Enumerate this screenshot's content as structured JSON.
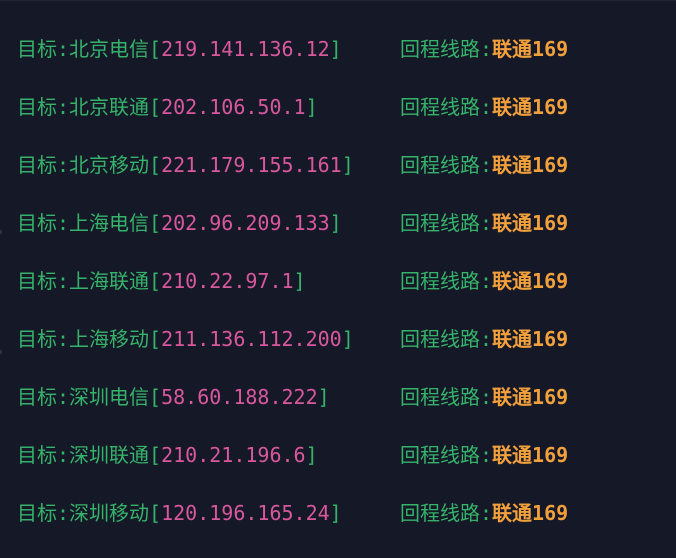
{
  "rows": [
    {
      "target_label": "目标:",
      "target_name": "北京电信",
      "ip": "219.141.136.12",
      "route_label": "回程线路:",
      "route_value": "联通169"
    },
    {
      "target_label": "目标:",
      "target_name": "北京联通",
      "ip": "202.106.50.1",
      "route_label": "回程线路:",
      "route_value": "联通169"
    },
    {
      "target_label": "目标:",
      "target_name": "北京移动",
      "ip": "221.179.155.161",
      "route_label": "回程线路:",
      "route_value": "联通169"
    },
    {
      "target_label": "目标:",
      "target_name": "上海电信",
      "ip": "202.96.209.133",
      "route_label": "回程线路:",
      "route_value": "联通169"
    },
    {
      "target_label": "目标:",
      "target_name": "上海联通",
      "ip": "210.22.97.1",
      "route_label": "回程线路:",
      "route_value": "联通169"
    },
    {
      "target_label": "目标:",
      "target_name": "上海移动",
      "ip": "211.136.112.200",
      "route_label": "回程线路:",
      "route_value": "联通169"
    },
    {
      "target_label": "目标:",
      "target_name": "深圳电信",
      "ip": "58.60.188.222",
      "route_label": "回程线路:",
      "route_value": "联通169"
    },
    {
      "target_label": "目标:",
      "target_name": "深圳联通",
      "ip": "210.21.196.6",
      "route_label": "回程线路:",
      "route_value": "联通169"
    },
    {
      "target_label": "目标:",
      "target_name": "深圳移动",
      "ip": "120.196.165.24",
      "route_label": "回程线路:",
      "route_value": "联通169"
    }
  ],
  "colors": {
    "background": "#151827",
    "label": "#35b36a",
    "ip": "#d9589d",
    "route": "#f2a03b"
  },
  "ip_brackets": {
    "open": "[",
    "close": "]"
  }
}
